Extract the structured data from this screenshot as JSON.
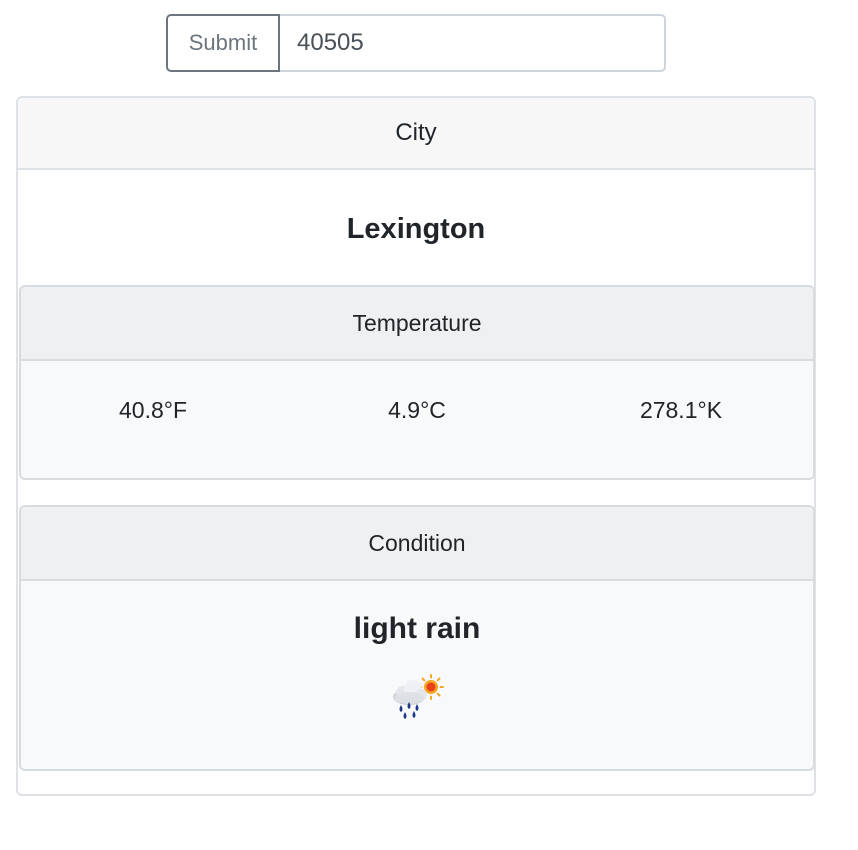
{
  "search": {
    "submit_label": "Submit",
    "zip_value": "40505"
  },
  "city": {
    "header": "City",
    "name": "Lexington"
  },
  "temperature": {
    "header": "Temperature",
    "fahrenheit": "40.8°F",
    "celsius": "4.9°C",
    "kelvin": "278.1°K"
  },
  "condition": {
    "header": "Condition",
    "description": "light rain",
    "icon": "light-rain-sun-icon"
  }
}
